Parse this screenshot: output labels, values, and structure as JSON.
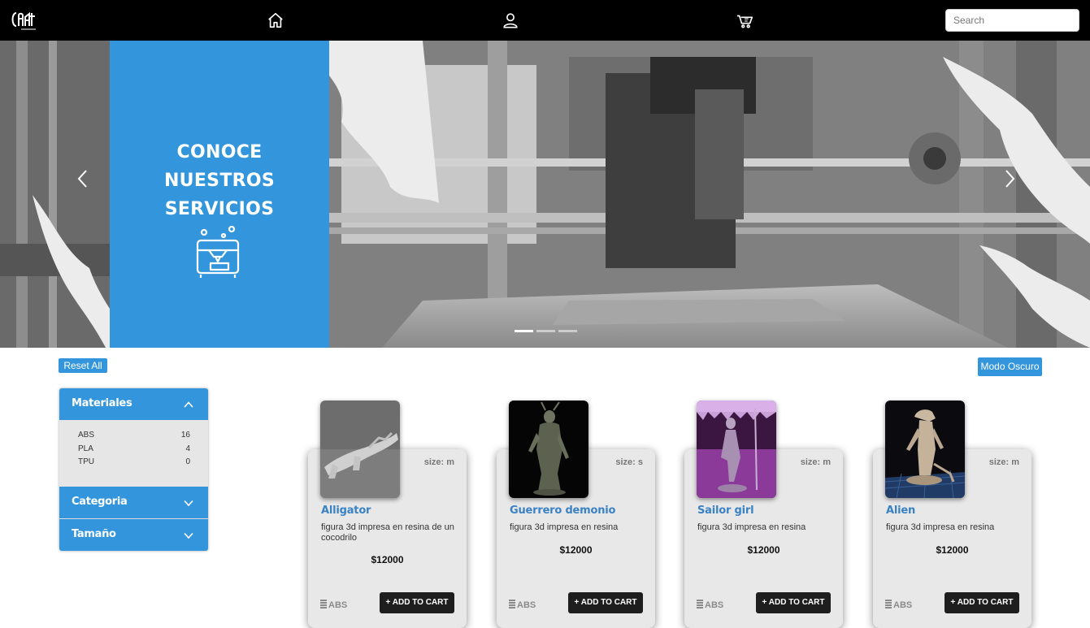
{
  "navbar": {
    "logo": {
      "icon": "craft-logo",
      "alt": "Craft logo"
    },
    "icons": [
      "home-icon",
      "user-icon",
      "cart-icon"
    ],
    "search": {
      "placeholder": "Search",
      "value": ""
    }
  },
  "hero": {
    "promo_title": "CONOCE\nNUESTROS\nSERVICIOS",
    "promo_icon": "3d-printer-icon",
    "indicators": [
      true,
      false,
      false
    ],
    "colors": {
      "promo": "#3396dc"
    }
  },
  "filters": {
    "reset_label": "Reset All",
    "dark_mode_label": "Modo Oscuro"
  },
  "sidebar": {
    "sections": [
      {
        "title": "Materiales",
        "expanded": true,
        "items": [
          {
            "name": "ABS",
            "count": "16"
          },
          {
            "name": "PLA",
            "count": "4"
          },
          {
            "name": "TPU",
            "count": "0"
          }
        ]
      },
      {
        "title": "Categoria",
        "expanded": false
      },
      {
        "title": "Tamaño",
        "expanded": false
      }
    ]
  },
  "products": [
    {
      "title": "Alligator",
      "size": "size: m",
      "description": "figura 3d impresa en resina de un cocodrilo",
      "price": "$12000",
      "material": "ABS",
      "button": "+ ADD TO CART"
    },
    {
      "title": "Guerrero demonio",
      "size": "size: s",
      "description": "figura 3d impresa en resina",
      "price": "$12000",
      "material": "ABS",
      "button": "+ ADD TO CART"
    },
    {
      "title": "Sailor girl",
      "size": "size: m",
      "description": "figura 3d impresa en resina",
      "price": "$12000",
      "material": "ABS",
      "button": "+ ADD TO CART"
    },
    {
      "title": "Alien",
      "size": "size: m",
      "description": "figura 3d impresa en resina",
      "price": "$12000",
      "material": "ABS",
      "button": "+ ADD TO CART"
    }
  ]
}
